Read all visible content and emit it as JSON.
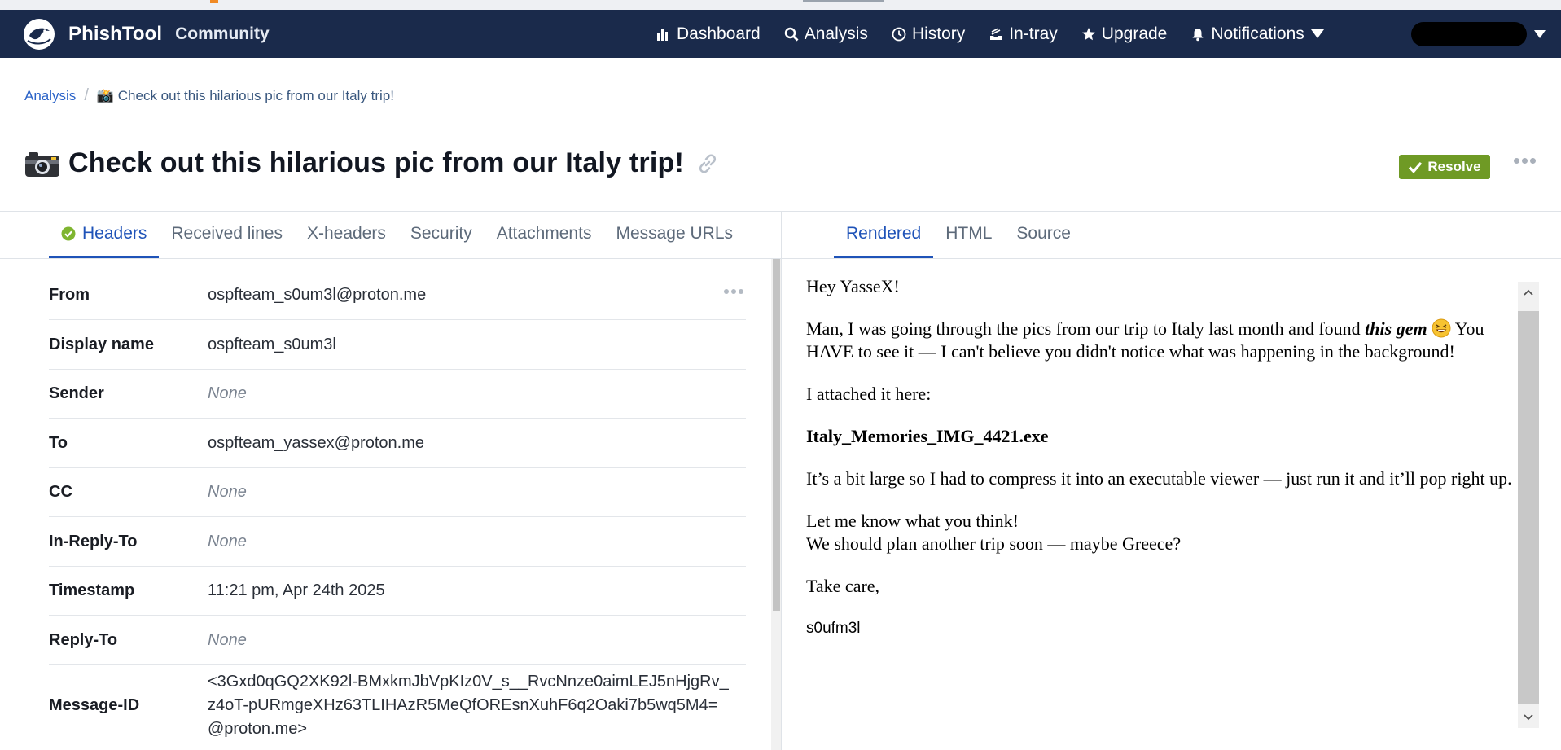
{
  "navbar": {
    "brand_name": "PhishTool",
    "brand_sub": "Community",
    "items": [
      {
        "label": "Dashboard",
        "icon": "bar-chart-icon"
      },
      {
        "label": "Analysis",
        "icon": "search-icon",
        "active": true
      },
      {
        "label": "History",
        "icon": "clock-icon"
      },
      {
        "label": "In-tray",
        "icon": "inbox-tray-icon"
      },
      {
        "label": "Upgrade",
        "icon": "star-icon"
      },
      {
        "label": "Notifications",
        "icon": "bell-icon"
      }
    ],
    "colors": {
      "background": "#1a2a4b"
    }
  },
  "breadcrumb": {
    "root": "Analysis",
    "current": "📸 Check out this hilarious pic from our Italy trip!"
  },
  "page": {
    "title": "Check out this hilarious pic from our Italy trip!",
    "title_icon": "camera-icon",
    "resolve_label": "Resolve",
    "resolve_color": "#6f9a25"
  },
  "left_tabs": [
    "Headers",
    "Received lines",
    "X-headers",
    "Security",
    "Attachments",
    "Message URLs"
  ],
  "right_tabs": [
    "Rendered",
    "HTML",
    "Source"
  ],
  "headers": {
    "rows": [
      {
        "label": "From",
        "value": "ospfteam_s0um3l@proton.me"
      },
      {
        "label": "Display name",
        "value": "ospfteam_s0um3l"
      },
      {
        "label": "Sender",
        "value": "None"
      },
      {
        "label": "To",
        "value": "ospfteam_yassex@proton.me"
      },
      {
        "label": "CC",
        "value": "None"
      },
      {
        "label": "In-Reply-To",
        "value": "None"
      },
      {
        "label": "Timestamp",
        "value": "11:21 pm, Apr 24th 2025"
      },
      {
        "label": "Reply-To",
        "value": "None"
      },
      {
        "label": "Message-ID",
        "value": "<3Gxd0qGQ2XK92l-BMxkmJbVpKIz0V_s__RvcNnze0aimLEJ5nHjgRv_z4oT-pURmgeXHz63TLIHAzR5MeQfOREsnXuhF6q2Oaki7b5wq5M4=@proton.me>"
      }
    ]
  },
  "email": {
    "greeting": "Hey YasseX!",
    "p1_before": "Man, I was going through the pics from our trip to Italy last month and found ",
    "p1_emph": "this gem",
    "p1_after": " You HAVE to see it — I can't believe you didn't notice what was happening in the background!",
    "p2": "I attached it here:",
    "attachment": "Italy_Memories_IMG_4421.exe",
    "p3": "It’s a bit large so I had to compress it into an executable viewer — just run it and it’ll pop right up.",
    "p4_line1": "Let me know what you think!",
    "p4_line2": "We should plan another trip soon — maybe Greece?",
    "closing": "Take care,",
    "signature": "s0ufm3l"
  }
}
